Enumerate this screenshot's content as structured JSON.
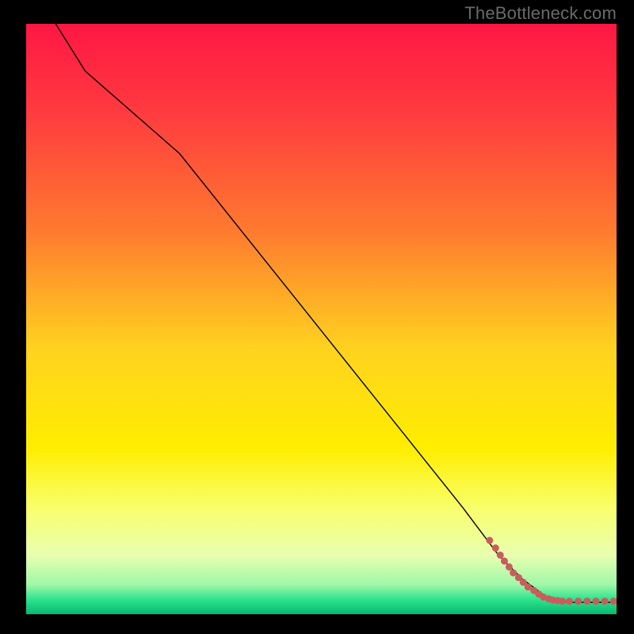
{
  "watermark": "TheBottleneck.com",
  "chart_data": {
    "type": "line",
    "title": "",
    "xlabel": "",
    "ylabel": "",
    "xlim": [
      0,
      100
    ],
    "ylim": [
      0,
      100
    ],
    "axes_visible": false,
    "grid": false,
    "background": {
      "type": "vertical_gradient",
      "stops": [
        {
          "pos": 0.0,
          "color": "#ff1744"
        },
        {
          "pos": 0.15,
          "color": "#ff3b3f"
        },
        {
          "pos": 0.35,
          "color": "#ff7a2f"
        },
        {
          "pos": 0.55,
          "color": "#ffd21f"
        },
        {
          "pos": 0.72,
          "color": "#ffee00"
        },
        {
          "pos": 0.82,
          "color": "#f9ff6b"
        },
        {
          "pos": 0.9,
          "color": "#e9ffb0"
        },
        {
          "pos": 0.95,
          "color": "#9ff7a8"
        },
        {
          "pos": 0.975,
          "color": "#2de38d"
        },
        {
          "pos": 1.0,
          "color": "#07b86f"
        }
      ]
    },
    "series": [
      {
        "name": "bottleneck-curve",
        "type": "line",
        "color": "#000000",
        "width": 1.4,
        "x": [
          5,
          10,
          18,
          26,
          34,
          42,
          50,
          58,
          66,
          74,
          80,
          84,
          88,
          92,
          96,
          100
        ],
        "y": [
          100,
          92,
          85,
          78,
          68,
          58,
          48,
          38,
          28,
          18,
          10,
          6,
          3,
          2,
          2,
          2
        ]
      },
      {
        "name": "optimal-region-markers",
        "type": "scatter",
        "color": "#c95d5d",
        "radius": 4.5,
        "x": [
          78.5,
          79.5,
          80.3,
          81.0,
          81.8,
          82.5,
          83.4,
          84.2,
          85.0,
          86.0,
          86.8,
          87.6,
          88.5,
          89.2,
          90.0,
          90.8,
          92.0,
          93.5,
          95.0,
          96.5,
          98.0,
          99.5
        ],
        "y": [
          12.5,
          11.2,
          10.0,
          9.0,
          8.0,
          7.0,
          6.2,
          5.4,
          4.6,
          4.0,
          3.4,
          2.9,
          2.6,
          2.4,
          2.3,
          2.2,
          2.2,
          2.2,
          2.2,
          2.2,
          2.2,
          2.2
        ]
      }
    ]
  }
}
